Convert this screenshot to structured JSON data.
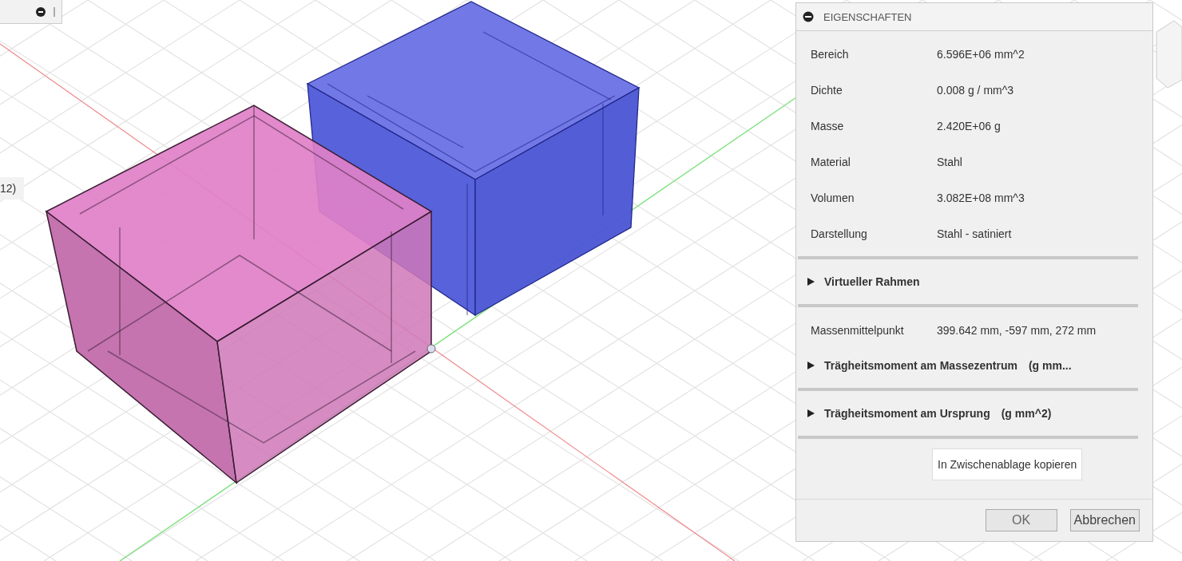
{
  "side_label": "12)",
  "properties_panel": {
    "title": "EIGENSCHAFTEN",
    "collapsed": false,
    "items": [
      {
        "kind": "property",
        "label": "Bereich",
        "value": "6.596E+06 mm^2"
      },
      {
        "kind": "property",
        "label": "Dichte",
        "value": "0.008 g / mm^3"
      },
      {
        "kind": "property",
        "label": "Masse",
        "value": "2.420E+06 g"
      },
      {
        "kind": "property",
        "label": "Material",
        "value": "Stahl"
      },
      {
        "kind": "property",
        "label": "Volumen",
        "value": "3.082E+08 mm^3"
      },
      {
        "kind": "property",
        "label": "Darstellung",
        "value": "Stahl - satiniert"
      },
      {
        "kind": "separator"
      },
      {
        "kind": "section",
        "label": "Virtueller Rahmen",
        "expanded": false
      },
      {
        "kind": "separator"
      },
      {
        "kind": "property",
        "label": "Massenmittelpunkt",
        "value": "399.642 mm, -597 mm, 272 mm"
      },
      {
        "kind": "section",
        "label": "Trägheitsmoment am Massezentrum",
        "unit": "(g mm...",
        "expanded": false
      },
      {
        "kind": "separator"
      },
      {
        "kind": "section",
        "label": "Trägheitsmoment am Ursprung",
        "unit": "(g mm^2)",
        "expanded": false
      },
      {
        "kind": "separator"
      }
    ],
    "copy_button": "In Zwischenablage kopieren",
    "buttons": [
      "OK",
      "Abbrechen"
    ]
  }
}
